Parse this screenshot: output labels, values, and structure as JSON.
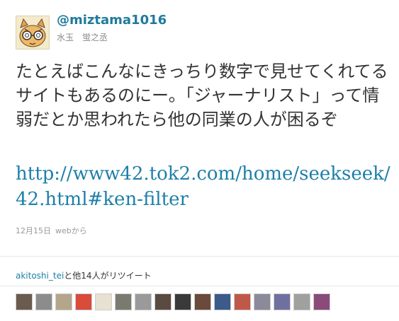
{
  "author": {
    "screen_name": "@miztama1016",
    "display_name": "水玉　蛍之丞",
    "avatar_icon": "cat-with-glasses-avatar-icon"
  },
  "tweet": {
    "text": "たとえばこんなにきっちり数字で見せてくれてるサイトもあるのにー。「ジャーナリスト」って情弱だとか思われたら他の同業の人が困るぞ",
    "link": "http://www42.tok2.com/home/seekseek/42.html#ken-filter",
    "date": "12月15日",
    "source": "webから"
  },
  "retweets": {
    "user": "akitoshi_tei",
    "suffix": "と他14人がリツイート",
    "avatar_colors": [
      "#6b5a4e",
      "#8c8c8c",
      "#b5a58a",
      "#d94b3a",
      "#e8e0d0",
      "#7a7a70",
      "#9a9a9a",
      "#5a4a40",
      "#3a3a3a",
      "#6a4a3a",
      "#3c5a8a",
      "#c0584a",
      "#8a8a9a",
      "#7070a0",
      "#a0a0a0",
      "#8a4a7a"
    ]
  }
}
